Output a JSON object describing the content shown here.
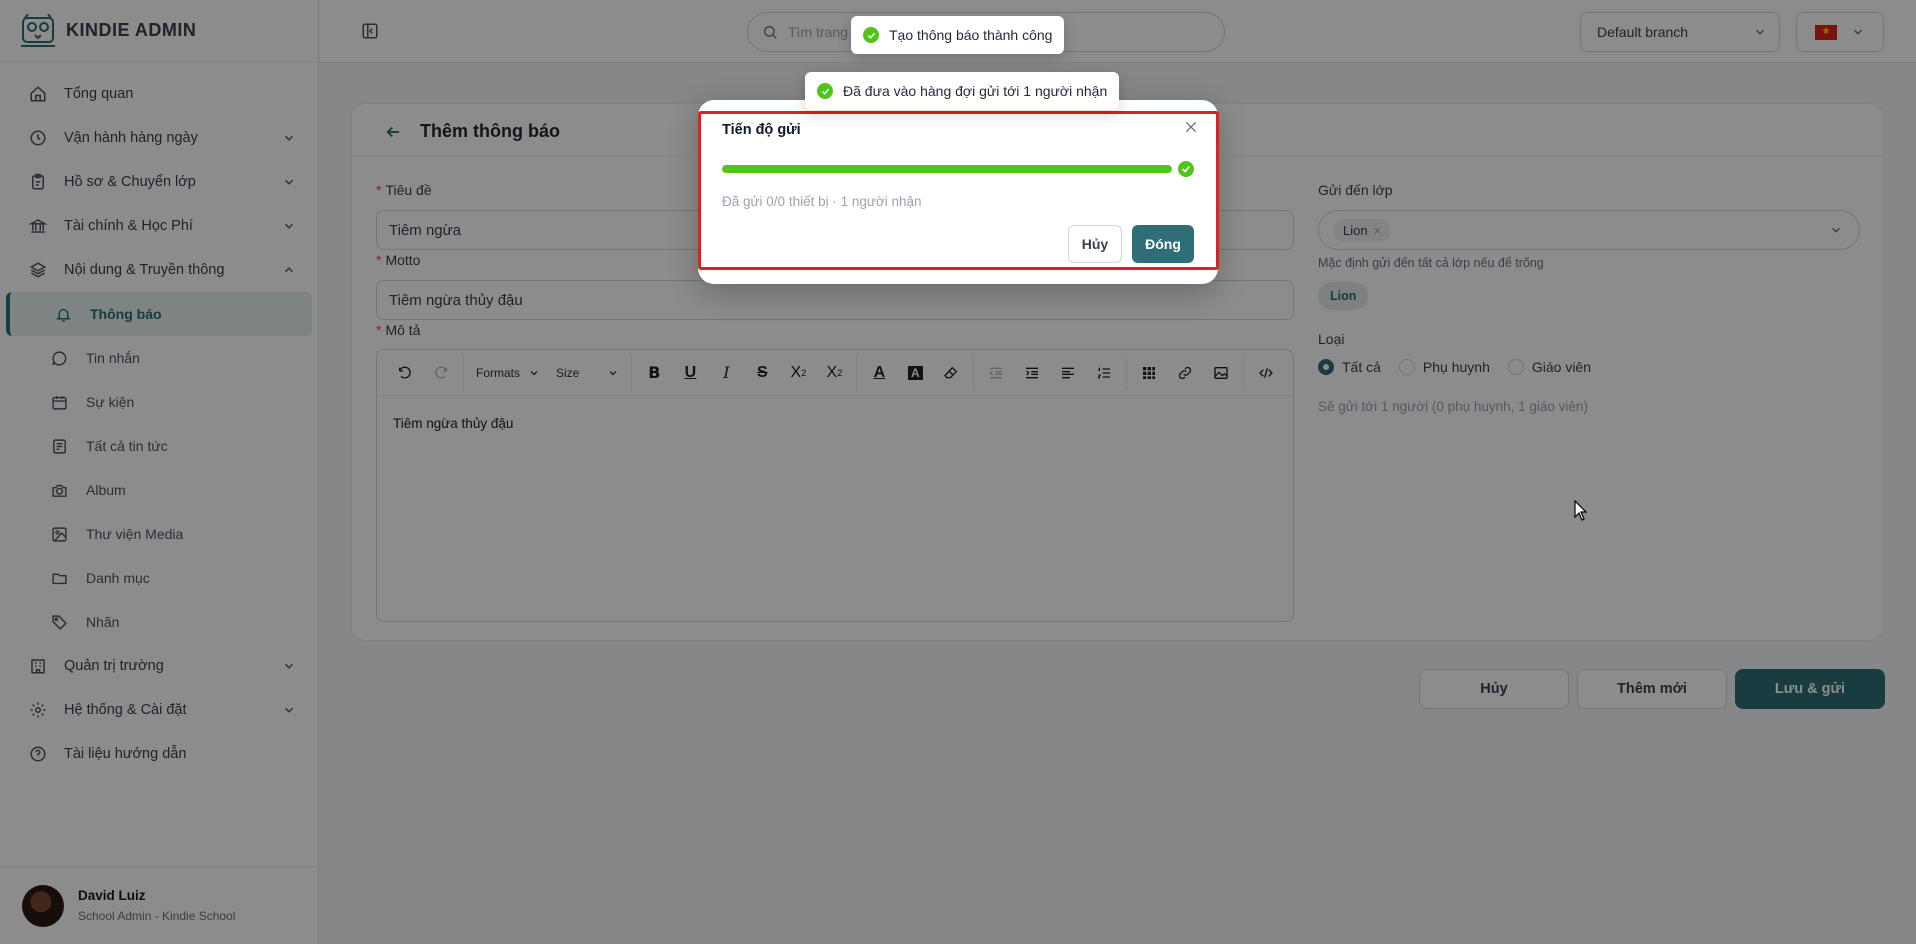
{
  "brand": {
    "name": "KINDIE ADMIN"
  },
  "sidebar": {
    "items": [
      {
        "label": "Tổng quan",
        "icon": "home-icon"
      },
      {
        "label": "Vận hành hàng ngày",
        "icon": "clock-icon"
      },
      {
        "label": "Hồ sơ & Chuyển lớp",
        "icon": "clipboard-icon"
      },
      {
        "label": "Tài chính & Học Phí",
        "icon": "bank-icon"
      },
      {
        "label": "Nội dung & Truyền thông",
        "icon": "layers-icon"
      },
      {
        "label": "Quản trị trường",
        "icon": "building-icon"
      },
      {
        "label": "Hệ thống & Cài đặt",
        "icon": "gear-icon"
      },
      {
        "label": "Tài liệu hướng dẫn",
        "icon": "help-icon"
      }
    ],
    "subitems": [
      {
        "label": "Thông báo",
        "icon": "bell-icon"
      },
      {
        "label": "Tin nhắn",
        "icon": "chat-icon"
      },
      {
        "label": "Sự kiện",
        "icon": "calendar-icon"
      },
      {
        "label": "Tất cả tin tức",
        "icon": "news-icon"
      },
      {
        "label": "Album",
        "icon": "camera-icon"
      },
      {
        "label": "Thư viện Media",
        "icon": "image-icon"
      },
      {
        "label": "Danh mục",
        "icon": "folder-icon"
      },
      {
        "label": "Nhãn",
        "icon": "tag-icon"
      }
    ]
  },
  "user": {
    "name": "David Luiz",
    "role": "School Admin - Kindie School"
  },
  "topbar": {
    "search_placeholder": "Tìm trang",
    "branch": "Default branch"
  },
  "page": {
    "title": "Thêm thông báo",
    "fields": {
      "title_label": "Tiêu đề",
      "title_value": "Tiêm ngừa",
      "motto_label": "Motto",
      "motto_value": "Tiêm ngừa thủy đậu",
      "desc_label": "Mô tả",
      "desc_value": "Tiêm ngừa thủy đậu"
    },
    "editor": {
      "formats": "Formats",
      "size": "Size"
    },
    "right": {
      "send_to_label": "Gửi đến lớp",
      "selected_tag": "Lion",
      "default_hint": "Mặc định gửi đến tất cả lớp nếu để trống",
      "chip": "Lion",
      "type_label": "Loại",
      "types": [
        "Tất cả",
        "Phụ huynh",
        "Giáo viên"
      ],
      "selected_type": "Tất cả",
      "summary": "Sẽ gửi tới 1 người (0 phụ huynh, 1 giáo viên)"
    },
    "buttons": {
      "cancel": "Hủy",
      "add_new": "Thêm mới",
      "save_send": "Lưu & gửi"
    }
  },
  "modal": {
    "title": "Tiến độ gửi",
    "progress": 1.0,
    "status": "Đã gửi 0/0 thiết bị · 1 người nhận",
    "cancel": "Hủy",
    "close": "Đóng"
  },
  "toasts": [
    "Tạo thông báo thành công",
    "Đã đưa vào hàng đợi gửi tới 1 người nhận"
  ],
  "colors": {
    "primary": "#2f6e76",
    "success": "#52c41a",
    "highlight": "#e0201d"
  }
}
